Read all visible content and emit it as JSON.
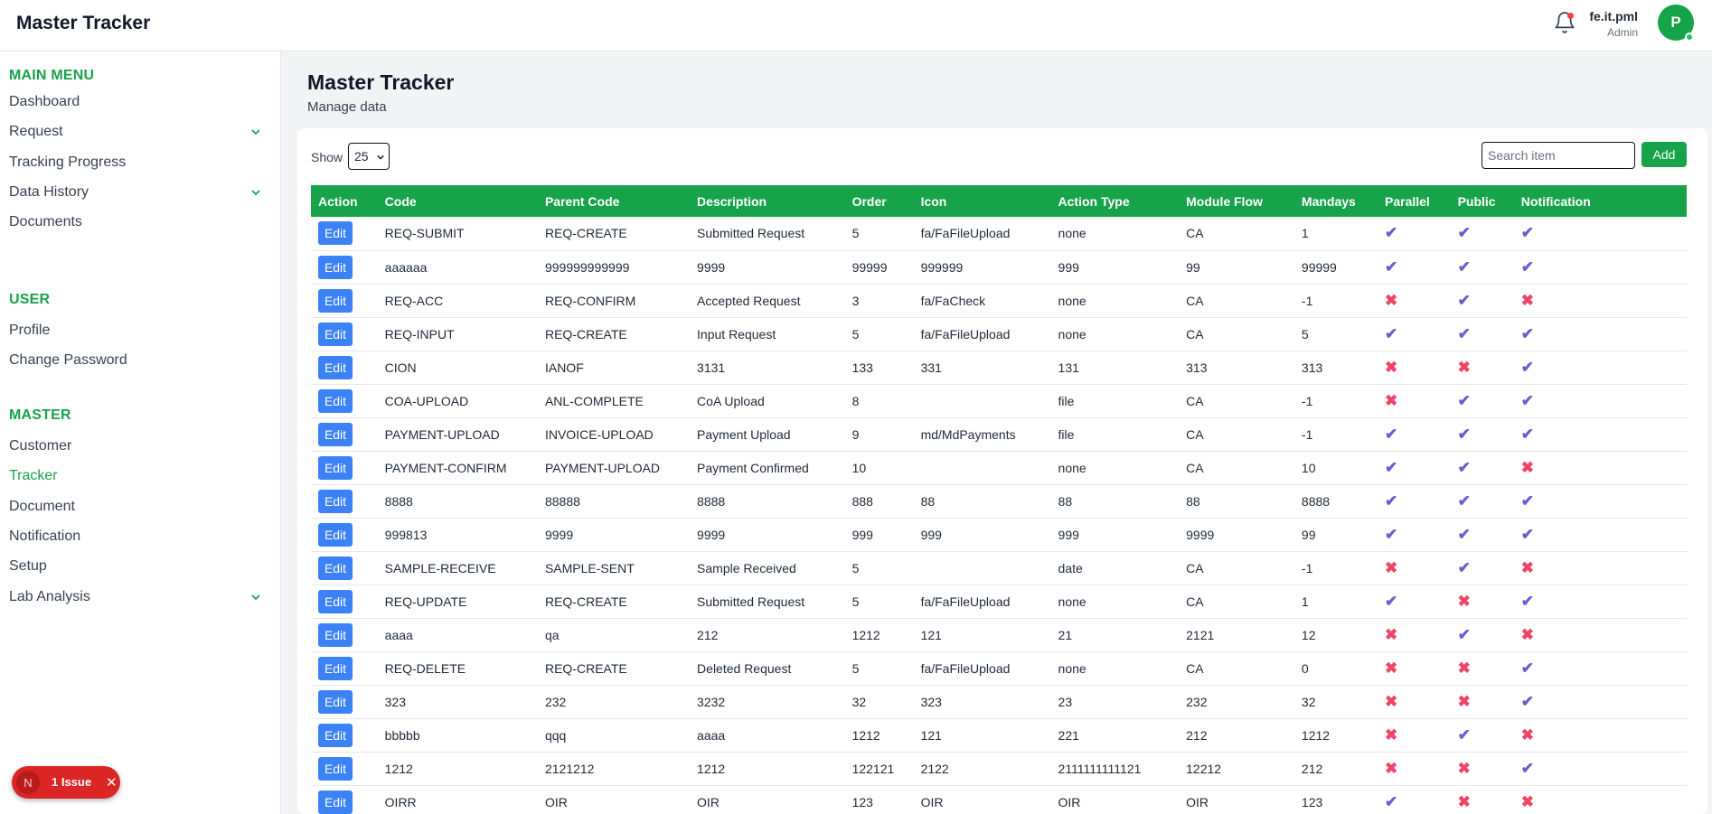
{
  "header": {
    "title": "Master Tracker",
    "user_name": "fe.it.pml",
    "user_role": "Admin",
    "avatar_initial": "P"
  },
  "sidebar": {
    "main_menu_title": "MAIN MENU",
    "main_items": [
      {
        "label": "Dashboard",
        "has_chevron": false
      },
      {
        "label": "Request",
        "has_chevron": true
      },
      {
        "label": "Tracking Progress",
        "has_chevron": false
      },
      {
        "label": "Data History",
        "has_chevron": true
      },
      {
        "label": "Documents",
        "has_chevron": false
      }
    ],
    "user_title": "USER",
    "user_items": [
      {
        "label": "Profile",
        "has_chevron": false
      },
      {
        "label": "Change Password",
        "has_chevron": false
      }
    ],
    "master_title": "MASTER",
    "master_items": [
      {
        "label": "Customer",
        "has_chevron": false
      },
      {
        "label": "Tracker",
        "has_chevron": false,
        "active": true
      },
      {
        "label": "Document",
        "has_chevron": false
      },
      {
        "label": "Notification",
        "has_chevron": false
      },
      {
        "label": "Setup",
        "has_chevron": false
      },
      {
        "label": "Lab Analysis",
        "has_chevron": true
      }
    ]
  },
  "page": {
    "title": "Master Tracker",
    "subtitle": "Manage data"
  },
  "toolbar": {
    "show_label": "Show",
    "page_size": "25",
    "search_placeholder": "Search item",
    "add_label": "Add"
  },
  "table": {
    "edit_label": "Edit",
    "yes_mark": "✔",
    "no_mark": "✖",
    "columns": [
      "Action",
      "Code",
      "Parent Code",
      "Description",
      "Order",
      "Icon",
      "Action Type",
      "Module Flow",
      "Mandays",
      "Parallel",
      "Public",
      "Notification"
    ],
    "rows": [
      {
        "code": "REQ-SUBMIT",
        "parent_code": "REQ-CREATE",
        "description": "Submitted Request",
        "order": "5",
        "icon": "fa/FaFileUpload",
        "action_type": "none",
        "module_flow": "CA",
        "mandays": "1",
        "parallel": true,
        "public": true,
        "notification": true
      },
      {
        "code": "aaaaaa",
        "parent_code": "999999999999",
        "description": "9999",
        "order": "99999",
        "icon": "999999",
        "action_type": "999",
        "module_flow": "99",
        "mandays": "99999",
        "parallel": true,
        "public": true,
        "notification": true
      },
      {
        "code": "REQ-ACC",
        "parent_code": "REQ-CONFIRM",
        "description": "Accepted Request",
        "order": "3",
        "icon": "fa/FaCheck",
        "action_type": "none",
        "module_flow": "CA",
        "mandays": "-1",
        "parallel": false,
        "public": true,
        "notification": false
      },
      {
        "code": "REQ-INPUT",
        "parent_code": "REQ-CREATE",
        "description": "Input Request",
        "order": "5",
        "icon": "fa/FaFileUpload",
        "action_type": "none",
        "module_flow": "CA",
        "mandays": "5",
        "parallel": true,
        "public": true,
        "notification": true
      },
      {
        "code": "CION",
        "parent_code": "IANOF",
        "description": "3131",
        "order": "133",
        "icon": "331",
        "action_type": "131",
        "module_flow": "313",
        "mandays": "313",
        "parallel": false,
        "public": false,
        "notification": true
      },
      {
        "code": "COA-UPLOAD",
        "parent_code": "ANL-COMPLETE",
        "description": "CoA Upload",
        "order": "8",
        "icon": "",
        "action_type": "file",
        "module_flow": "CA",
        "mandays": "-1",
        "parallel": false,
        "public": true,
        "notification": true
      },
      {
        "code": "PAYMENT-UPLOAD",
        "parent_code": "INVOICE-UPLOAD",
        "description": "Payment Upload",
        "order": "9",
        "icon": "md/MdPayments",
        "action_type": "file",
        "module_flow": "CA",
        "mandays": "-1",
        "parallel": true,
        "public": true,
        "notification": true
      },
      {
        "code": "PAYMENT-CONFIRM",
        "parent_code": "PAYMENT-UPLOAD",
        "description": "Payment Confirmed",
        "order": "10",
        "icon": "",
        "action_type": "none",
        "module_flow": "CA",
        "mandays": "10",
        "parallel": true,
        "public": true,
        "notification": false
      },
      {
        "code": "8888",
        "parent_code": "88888",
        "description": "8888",
        "order": "888",
        "icon": "88",
        "action_type": "88",
        "module_flow": "88",
        "mandays": "8888",
        "parallel": true,
        "public": true,
        "notification": true
      },
      {
        "code": "999813",
        "parent_code": "9999",
        "description": "9999",
        "order": "999",
        "icon": "999",
        "action_type": "999",
        "module_flow": "9999",
        "mandays": "99",
        "parallel": true,
        "public": true,
        "notification": true
      },
      {
        "code": "SAMPLE-RECEIVE",
        "parent_code": "SAMPLE-SENT",
        "description": "Sample Received",
        "order": "5",
        "icon": "",
        "action_type": "date",
        "module_flow": "CA",
        "mandays": "-1",
        "parallel": false,
        "public": true,
        "notification": false
      },
      {
        "code": "REQ-UPDATE",
        "parent_code": "REQ-CREATE",
        "description": "Submitted Request",
        "order": "5",
        "icon": "fa/FaFileUpload",
        "action_type": "none",
        "module_flow": "CA",
        "mandays": "1",
        "parallel": true,
        "public": false,
        "notification": true
      },
      {
        "code": "aaaa",
        "parent_code": "qa",
        "description": "212",
        "order": "1212",
        "icon": "121",
        "action_type": "21",
        "module_flow": "2121",
        "mandays": "12",
        "parallel": false,
        "public": true,
        "notification": false
      },
      {
        "code": "REQ-DELETE",
        "parent_code": "REQ-CREATE",
        "description": "Deleted Request",
        "order": "5",
        "icon": "fa/FaFileUpload",
        "action_type": "none",
        "module_flow": "CA",
        "mandays": "0",
        "parallel": false,
        "public": false,
        "notification": true
      },
      {
        "code": "323",
        "parent_code": "232",
        "description": "3232",
        "order": "32",
        "icon": "323",
        "action_type": "23",
        "module_flow": "232",
        "mandays": "32",
        "parallel": false,
        "public": false,
        "notification": true
      },
      {
        "code": "bbbbb",
        "parent_code": "qqq",
        "description": "aaaa",
        "order": "1212",
        "icon": "121",
        "action_type": "221",
        "module_flow": "212",
        "mandays": "1212",
        "parallel": false,
        "public": true,
        "notification": false
      },
      {
        "code": "1212",
        "parent_code": "2121212",
        "description": "1212",
        "order": "122121",
        "icon": "2122",
        "action_type": "2111111111121",
        "module_flow": "12212",
        "mandays": "212",
        "parallel": false,
        "public": false,
        "notification": true
      },
      {
        "code": "OIRR",
        "parent_code": "OIR",
        "description": "OIR",
        "order": "123",
        "icon": "OIR",
        "action_type": "OIR",
        "module_flow": "OIR",
        "mandays": "123",
        "parallel": true,
        "public": false,
        "notification": false
      }
    ]
  },
  "issue_badge": {
    "initial": "N",
    "label": "1 Issue",
    "close": "✕"
  },
  "colors": {
    "brand_green": "#16a34a",
    "edit_blue": "#3b82f6",
    "check_purple": "#6d5bd0",
    "cross_red": "#ef4466",
    "issue_red": "#dc2626"
  }
}
